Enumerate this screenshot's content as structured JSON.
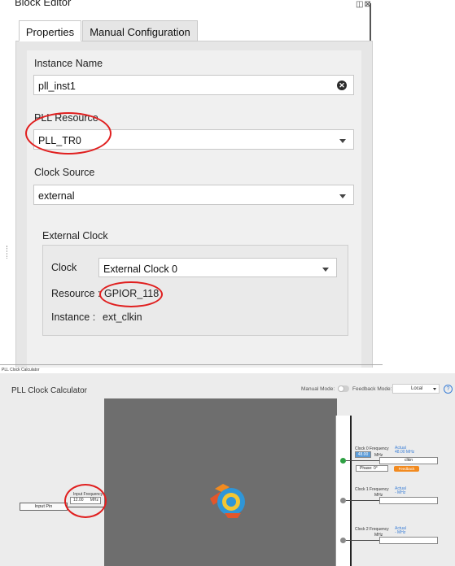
{
  "block_editor": {
    "title": "Block Editor",
    "window_icons": "◫⊠",
    "tabs": [
      {
        "label": "Properties",
        "active": true
      },
      {
        "label": "Manual Configuration",
        "active": false
      }
    ],
    "instance_name": {
      "label": "Instance Name",
      "value": "pll_inst1"
    },
    "pll_resource": {
      "label": "PLL Resource",
      "value": "PLL_TR0"
    },
    "clock_source": {
      "label": "Clock Source",
      "value": "external"
    },
    "external_clock": {
      "heading": "External Clock",
      "clock_label": "Clock",
      "clock_value": "External Clock 0",
      "resource_label": "Resource :",
      "resource_value": "GPIOR_118",
      "instance_label": "Instance :",
      "instance_value": "ext_clkin"
    }
  },
  "calculator": {
    "caption": "PLL Clock Calculator",
    "title": "PLL Clock Calculator",
    "manual_mode_label": "Manual Mode:",
    "feedback_mode_label": "Feedback Mode:",
    "feedback_mode_value": "Local",
    "help": "?",
    "input_pin": "Input Pin",
    "input_frequency_label": "Input Frequency",
    "input_frequency_value": "12.00",
    "input_frequency_unit": "MHz",
    "outputs": [
      {
        "label": "Clock 0 Frequency",
        "actual_label": "Actual",
        "actual_value": "48.00 MHz",
        "value": "48.00",
        "unit": "MHz",
        "name": "clkin",
        "phase": "Phase: 0°",
        "feedback": "Feedback"
      },
      {
        "label": "Clock 1 Frequency",
        "actual_label": "Actual",
        "actual_value": "- MHz",
        "unit": "MHz"
      },
      {
        "label": "Clock 2 Frequency",
        "actual_label": "Actual",
        "actual_value": "- MHz",
        "unit": "MHz"
      }
    ],
    "colors": {
      "active_output": "#2ea043",
      "inactive_output": "#8a8a8a",
      "feedback_button": "#f28a1f",
      "annotation": "#e01f1f"
    }
  }
}
